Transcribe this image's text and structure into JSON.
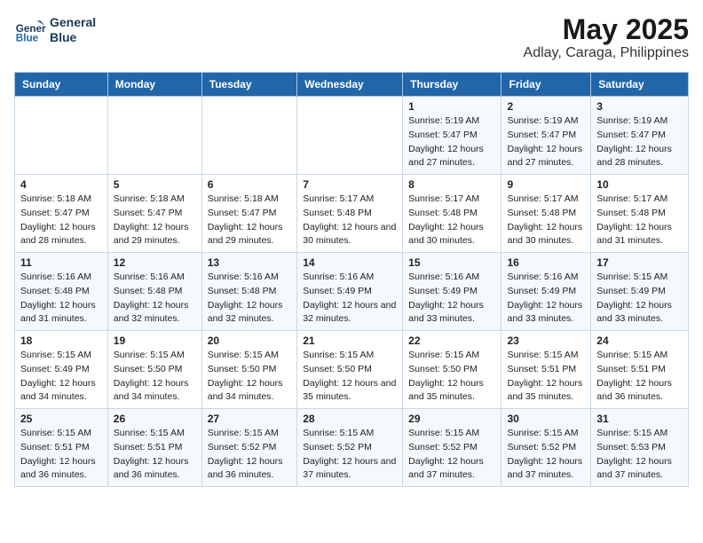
{
  "header": {
    "logo_line1": "General",
    "logo_line2": "Blue",
    "title": "May 2025",
    "subtitle": "Adlay, Caraga, Philippines"
  },
  "days_of_week": [
    "Sunday",
    "Monday",
    "Tuesday",
    "Wednesday",
    "Thursday",
    "Friday",
    "Saturday"
  ],
  "weeks": [
    [
      {
        "day": "",
        "sunrise": "",
        "sunset": "",
        "daylight": ""
      },
      {
        "day": "",
        "sunrise": "",
        "sunset": "",
        "daylight": ""
      },
      {
        "day": "",
        "sunrise": "",
        "sunset": "",
        "daylight": ""
      },
      {
        "day": "",
        "sunrise": "",
        "sunset": "",
        "daylight": ""
      },
      {
        "day": "1",
        "sunrise": "Sunrise: 5:19 AM",
        "sunset": "Sunset: 5:47 PM",
        "daylight": "Daylight: 12 hours and 27 minutes."
      },
      {
        "day": "2",
        "sunrise": "Sunrise: 5:19 AM",
        "sunset": "Sunset: 5:47 PM",
        "daylight": "Daylight: 12 hours and 27 minutes."
      },
      {
        "day": "3",
        "sunrise": "Sunrise: 5:19 AM",
        "sunset": "Sunset: 5:47 PM",
        "daylight": "Daylight: 12 hours and 28 minutes."
      }
    ],
    [
      {
        "day": "4",
        "sunrise": "Sunrise: 5:18 AM",
        "sunset": "Sunset: 5:47 PM",
        "daylight": "Daylight: 12 hours and 28 minutes."
      },
      {
        "day": "5",
        "sunrise": "Sunrise: 5:18 AM",
        "sunset": "Sunset: 5:47 PM",
        "daylight": "Daylight: 12 hours and 29 minutes."
      },
      {
        "day": "6",
        "sunrise": "Sunrise: 5:18 AM",
        "sunset": "Sunset: 5:47 PM",
        "daylight": "Daylight: 12 hours and 29 minutes."
      },
      {
        "day": "7",
        "sunrise": "Sunrise: 5:17 AM",
        "sunset": "Sunset: 5:48 PM",
        "daylight": "Daylight: 12 hours and 30 minutes."
      },
      {
        "day": "8",
        "sunrise": "Sunrise: 5:17 AM",
        "sunset": "Sunset: 5:48 PM",
        "daylight": "Daylight: 12 hours and 30 minutes."
      },
      {
        "day": "9",
        "sunrise": "Sunrise: 5:17 AM",
        "sunset": "Sunset: 5:48 PM",
        "daylight": "Daylight: 12 hours and 30 minutes."
      },
      {
        "day": "10",
        "sunrise": "Sunrise: 5:17 AM",
        "sunset": "Sunset: 5:48 PM",
        "daylight": "Daylight: 12 hours and 31 minutes."
      }
    ],
    [
      {
        "day": "11",
        "sunrise": "Sunrise: 5:16 AM",
        "sunset": "Sunset: 5:48 PM",
        "daylight": "Daylight: 12 hours and 31 minutes."
      },
      {
        "day": "12",
        "sunrise": "Sunrise: 5:16 AM",
        "sunset": "Sunset: 5:48 PM",
        "daylight": "Daylight: 12 hours and 32 minutes."
      },
      {
        "day": "13",
        "sunrise": "Sunrise: 5:16 AM",
        "sunset": "Sunset: 5:48 PM",
        "daylight": "Daylight: 12 hours and 32 minutes."
      },
      {
        "day": "14",
        "sunrise": "Sunrise: 5:16 AM",
        "sunset": "Sunset: 5:49 PM",
        "daylight": "Daylight: 12 hours and 32 minutes."
      },
      {
        "day": "15",
        "sunrise": "Sunrise: 5:16 AM",
        "sunset": "Sunset: 5:49 PM",
        "daylight": "Daylight: 12 hours and 33 minutes."
      },
      {
        "day": "16",
        "sunrise": "Sunrise: 5:16 AM",
        "sunset": "Sunset: 5:49 PM",
        "daylight": "Daylight: 12 hours and 33 minutes."
      },
      {
        "day": "17",
        "sunrise": "Sunrise: 5:15 AM",
        "sunset": "Sunset: 5:49 PM",
        "daylight": "Daylight: 12 hours and 33 minutes."
      }
    ],
    [
      {
        "day": "18",
        "sunrise": "Sunrise: 5:15 AM",
        "sunset": "Sunset: 5:49 PM",
        "daylight": "Daylight: 12 hours and 34 minutes."
      },
      {
        "day": "19",
        "sunrise": "Sunrise: 5:15 AM",
        "sunset": "Sunset: 5:50 PM",
        "daylight": "Daylight: 12 hours and 34 minutes."
      },
      {
        "day": "20",
        "sunrise": "Sunrise: 5:15 AM",
        "sunset": "Sunset: 5:50 PM",
        "daylight": "Daylight: 12 hours and 34 minutes."
      },
      {
        "day": "21",
        "sunrise": "Sunrise: 5:15 AM",
        "sunset": "Sunset: 5:50 PM",
        "daylight": "Daylight: 12 hours and 35 minutes."
      },
      {
        "day": "22",
        "sunrise": "Sunrise: 5:15 AM",
        "sunset": "Sunset: 5:50 PM",
        "daylight": "Daylight: 12 hours and 35 minutes."
      },
      {
        "day": "23",
        "sunrise": "Sunrise: 5:15 AM",
        "sunset": "Sunset: 5:51 PM",
        "daylight": "Daylight: 12 hours and 35 minutes."
      },
      {
        "day": "24",
        "sunrise": "Sunrise: 5:15 AM",
        "sunset": "Sunset: 5:51 PM",
        "daylight": "Daylight: 12 hours and 36 minutes."
      }
    ],
    [
      {
        "day": "25",
        "sunrise": "Sunrise: 5:15 AM",
        "sunset": "Sunset: 5:51 PM",
        "daylight": "Daylight: 12 hours and 36 minutes."
      },
      {
        "day": "26",
        "sunrise": "Sunrise: 5:15 AM",
        "sunset": "Sunset: 5:51 PM",
        "daylight": "Daylight: 12 hours and 36 minutes."
      },
      {
        "day": "27",
        "sunrise": "Sunrise: 5:15 AM",
        "sunset": "Sunset: 5:52 PM",
        "daylight": "Daylight: 12 hours and 36 minutes."
      },
      {
        "day": "28",
        "sunrise": "Sunrise: 5:15 AM",
        "sunset": "Sunset: 5:52 PM",
        "daylight": "Daylight: 12 hours and 37 minutes."
      },
      {
        "day": "29",
        "sunrise": "Sunrise: 5:15 AM",
        "sunset": "Sunset: 5:52 PM",
        "daylight": "Daylight: 12 hours and 37 minutes."
      },
      {
        "day": "30",
        "sunrise": "Sunrise: 5:15 AM",
        "sunset": "Sunset: 5:52 PM",
        "daylight": "Daylight: 12 hours and 37 minutes."
      },
      {
        "day": "31",
        "sunrise": "Sunrise: 5:15 AM",
        "sunset": "Sunset: 5:53 PM",
        "daylight": "Daylight: 12 hours and 37 minutes."
      }
    ]
  ]
}
